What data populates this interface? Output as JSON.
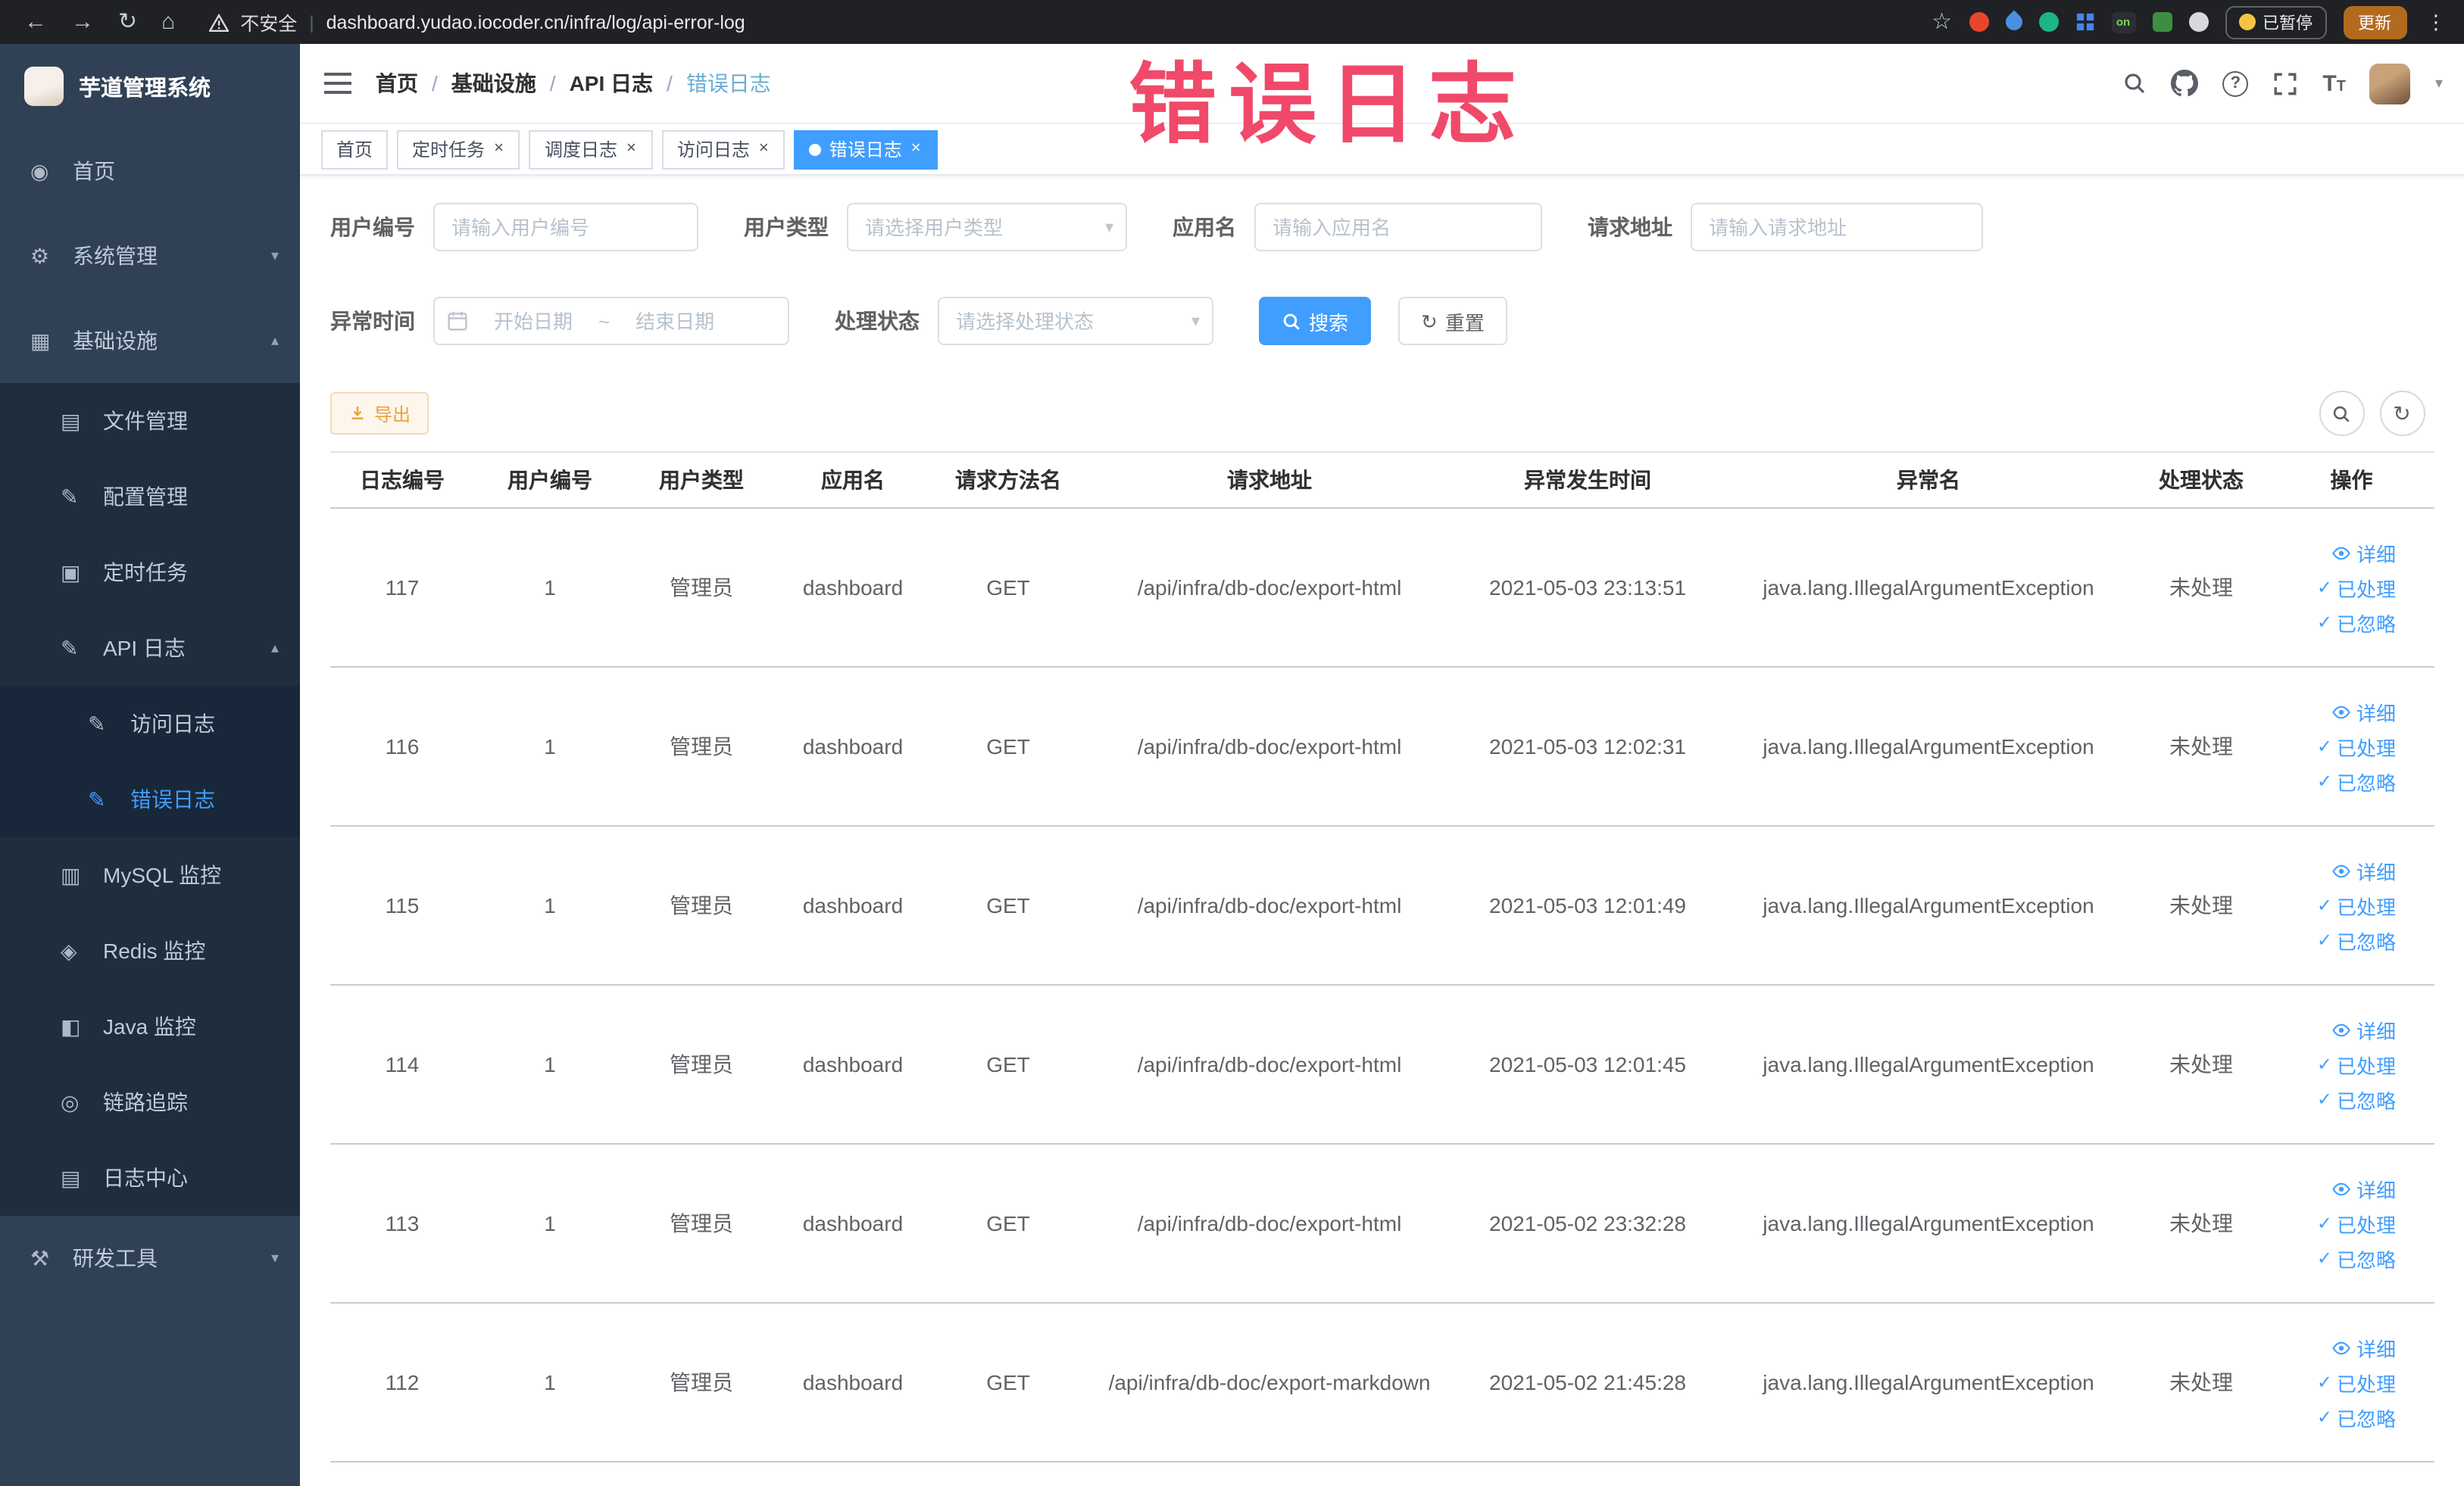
{
  "browser": {
    "security_label": "不安全",
    "divider": "|",
    "url": "dashboard.yudao.iocoder.cn/infra/log/api-error-log",
    "extension_on_badge": "on",
    "paused_label": "已暂停",
    "update_label": "更新"
  },
  "annotation": {
    "text": "错误日志"
  },
  "colors": {
    "accent": "#409eff",
    "sidebar_bg": "#304156",
    "sidebar_submenu_bg": "#1f2d3d",
    "active_tab_bg": "#409eff",
    "annotation": "#f0496a",
    "export_text": "#e6a23c",
    "export_bg": "#fdf6ec"
  },
  "icons": {
    "back": "←",
    "forward": "→",
    "reload": "↻",
    "home": "⌂",
    "star": "☆",
    "kebab": "⋮",
    "chevron_down": "▾",
    "chevron_up": "▴",
    "caret_down": "▾",
    "close": "×",
    "check": "✓",
    "refresh": "↻",
    "question": "?",
    "text_big": "T",
    "text_small": "T",
    "menu_home": "◉",
    "menu_gear": "⚙",
    "menu_grid": "▦",
    "menu_file": "▤",
    "menu_edit": "✎",
    "menu_doc": "▣",
    "menu_db": "▥",
    "menu_redis": "◈",
    "menu_java": "◧",
    "menu_trace": "◎",
    "menu_log": "▤",
    "menu_tools": "⚒"
  },
  "sidebar": {
    "logo_title": "芋道管理系统",
    "home": "首页",
    "system": "系统管理",
    "infra": "基础设施",
    "file": "文件管理",
    "config": "配置管理",
    "job": "定时任务",
    "api_log": "API 日志",
    "access_log": "访问日志",
    "error_log": "错误日志",
    "mysql": "MySQL 监控",
    "redis": "Redis 监控",
    "java": "Java 监控",
    "trace": "链路追踪",
    "log_center": "日志中心",
    "devtools": "研发工具"
  },
  "breadcrumb": {
    "separator": "/",
    "items": [
      "首页",
      "基础设施",
      "API 日志",
      "错误日志"
    ]
  },
  "tabs": {
    "items": [
      {
        "label": "首页",
        "closable": false,
        "active": false
      },
      {
        "label": "定时任务",
        "closable": true,
        "active": false
      },
      {
        "label": "调度日志",
        "closable": true,
        "active": false
      },
      {
        "label": "访问日志",
        "closable": true,
        "active": false
      },
      {
        "label": "错误日志",
        "closable": true,
        "active": true
      }
    ]
  },
  "filters": {
    "user_id": {
      "label": "用户编号",
      "placeholder": "请输入用户编号"
    },
    "user_type": {
      "label": "用户类型",
      "placeholder": "请选择用户类型"
    },
    "app_name": {
      "label": "应用名",
      "placeholder": "请输入应用名"
    },
    "request_url": {
      "label": "请求地址",
      "placeholder": "请输入请求地址"
    },
    "exception_time": {
      "label": "异常时间",
      "start_placeholder": "开始日期",
      "separator": "~",
      "end_placeholder": "结束日期"
    },
    "process_status": {
      "label": "处理状态",
      "placeholder": "请选择处理状态"
    },
    "search_button": "搜索",
    "reset_button": "重置"
  },
  "toolbar": {
    "export_button": "导出"
  },
  "table": {
    "columns": [
      "日志编号",
      "用户编号",
      "用户类型",
      "应用名",
      "请求方法名",
      "请求地址",
      "异常发生时间",
      "异常名",
      "处理状态",
      "操作"
    ],
    "actions": {
      "detail": "详细",
      "processed": "已处理",
      "ignored": "已忽略"
    },
    "rows": [
      {
        "id": "117",
        "user_id": "1",
        "user_type": "管理员",
        "app": "dashboard",
        "method": "GET",
        "url": "/api/infra/db-doc/export-html",
        "time": "2021-05-03 23:13:51",
        "exception": "java.lang.IllegalArgumentException",
        "status": "未处理"
      },
      {
        "id": "116",
        "user_id": "1",
        "user_type": "管理员",
        "app": "dashboard",
        "method": "GET",
        "url": "/api/infra/db-doc/export-html",
        "time": "2021-05-03 12:02:31",
        "exception": "java.lang.IllegalArgumentException",
        "status": "未处理"
      },
      {
        "id": "115",
        "user_id": "1",
        "user_type": "管理员",
        "app": "dashboard",
        "method": "GET",
        "url": "/api/infra/db-doc/export-html",
        "time": "2021-05-03 12:01:49",
        "exception": "java.lang.IllegalArgumentException",
        "status": "未处理"
      },
      {
        "id": "114",
        "user_id": "1",
        "user_type": "管理员",
        "app": "dashboard",
        "method": "GET",
        "url": "/api/infra/db-doc/export-html",
        "time": "2021-05-03 12:01:45",
        "exception": "java.lang.IllegalArgumentException",
        "status": "未处理"
      },
      {
        "id": "113",
        "user_id": "1",
        "user_type": "管理员",
        "app": "dashboard",
        "method": "GET",
        "url": "/api/infra/db-doc/export-html",
        "time": "2021-05-02 23:32:28",
        "exception": "java.lang.IllegalArgumentException",
        "status": "未处理"
      },
      {
        "id": "112",
        "user_id": "1",
        "user_type": "管理员",
        "app": "dashboard",
        "method": "GET",
        "url": "/api/infra/db-doc/export-markdown",
        "time": "2021-05-02 21:45:28",
        "exception": "java.lang.IllegalArgumentException",
        "status": "未处理"
      }
    ]
  }
}
